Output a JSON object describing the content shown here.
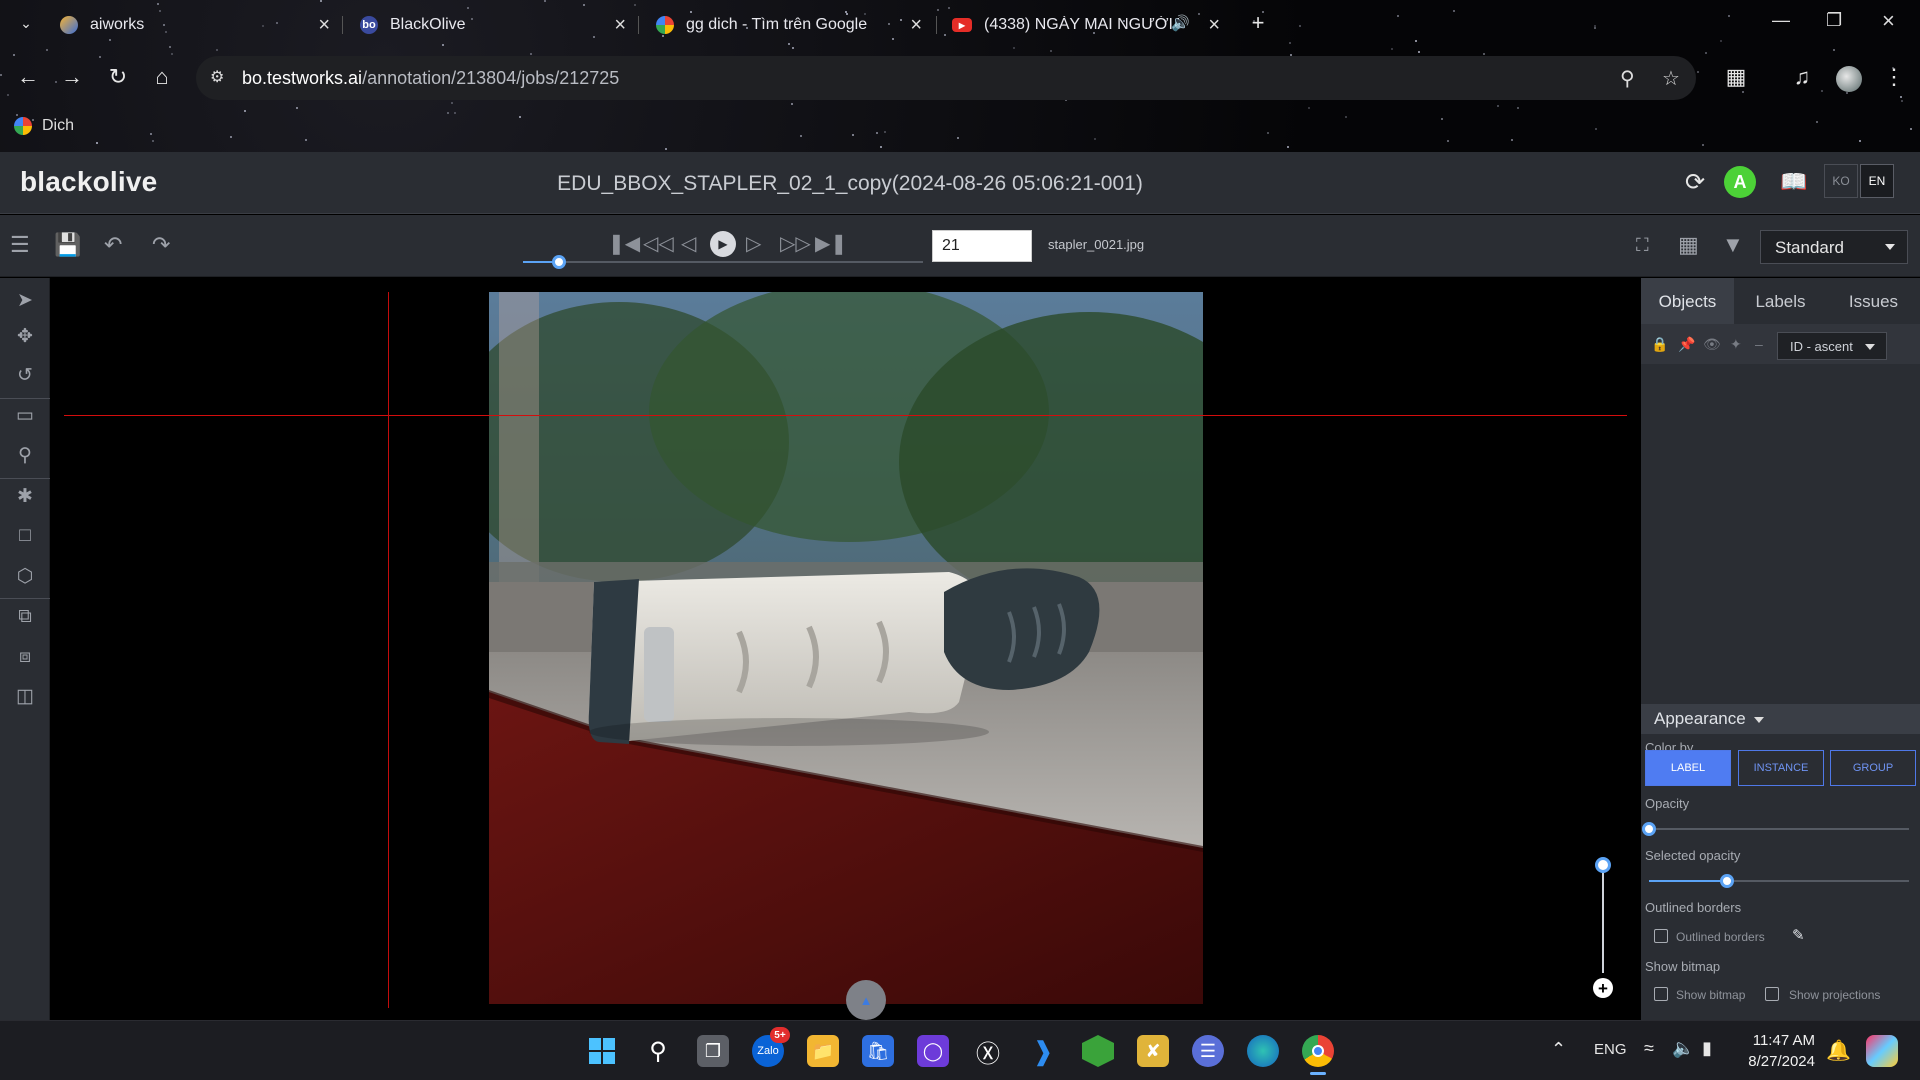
{
  "browser": {
    "tabs": [
      {
        "title": "aiworks",
        "favicon": "aiworks-logo-icon",
        "active": false
      },
      {
        "title": "BlackOlive",
        "favicon": "blackolive-bo-icon",
        "active": true
      },
      {
        "title": "gg dich - Tìm trên Google",
        "favicon": "google-g-icon",
        "active": false
      },
      {
        "title": "(4338) NGÀY MAI NGƯỜI TA",
        "favicon": "youtube-icon",
        "active": false,
        "audio": true
      }
    ],
    "url_host": "bo.testworks.ai",
    "url_path": "/annotation/213804/jobs/212725",
    "bookmark": "Dich"
  },
  "app": {
    "logo": "blackolive",
    "job_title": "EDU_BBOX_STAPLER_02_1_copy(2024-08-26 05:06:21-001)",
    "avatar_letter": "A",
    "avatar_color": "#4cd137",
    "lang_ko": "KO",
    "lang_en": "EN",
    "active_lang": "EN"
  },
  "toolbar": {
    "frame_number": "21",
    "frame_progress": 0.09,
    "filename": "stapler_0021.jpg",
    "view_mode": "Standard"
  },
  "canvas": {
    "zoom_level": 1.0,
    "crosshair_color": "#d40d0d"
  },
  "panel": {
    "tabs": [
      "Objects",
      "Labels",
      "Issues"
    ],
    "active_tab": "Objects",
    "sort": "ID - ascent",
    "appearance_title": "Appearance",
    "color_by_label": "Color by",
    "color_by_options": [
      "LABEL",
      "INSTANCE",
      "GROUP"
    ],
    "color_by_active": "LABEL",
    "opacity_label": "Opacity",
    "opacity_value": 0.0,
    "selected_opacity_label": "Selected opacity",
    "selected_opacity_value": 0.3,
    "outlined_borders_title": "Outlined borders",
    "outlined_borders_checkbox": "Outlined borders",
    "show_bitmap_title": "Show bitmap",
    "show_bitmap_checkbox": "Show bitmap",
    "show_projections_checkbox": "Show projections",
    "accent": "#4f7cf2"
  },
  "taskbar": {
    "notification_badge": "5+",
    "language": "ENG",
    "time": "11:47 AM",
    "date": "8/27/2024"
  }
}
